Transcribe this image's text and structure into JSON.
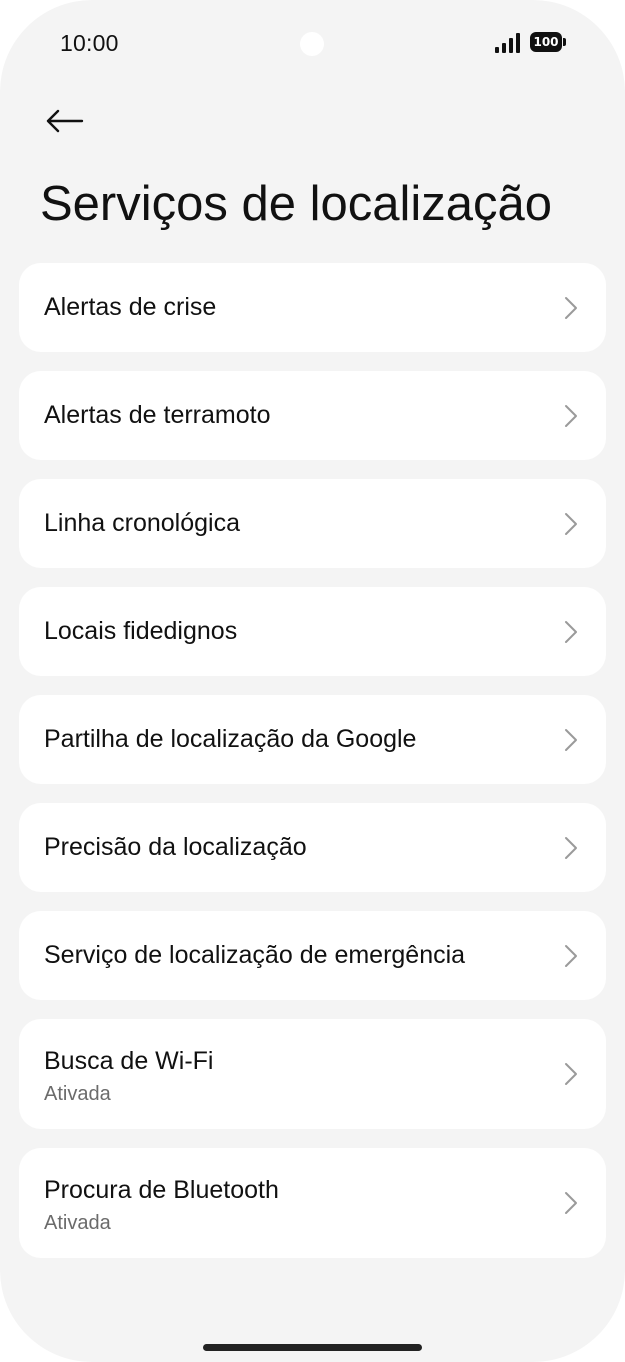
{
  "status_bar": {
    "time": "10:00",
    "battery": "100",
    "signal_icon": "signal-bars-icon",
    "battery_icon": "battery-icon"
  },
  "header": {
    "back_icon": "arrow-left-icon",
    "title": "Serviços de localização"
  },
  "items": [
    {
      "label": "Alertas de crise",
      "subtitle": ""
    },
    {
      "label": "Alertas de terramoto",
      "subtitle": ""
    },
    {
      "label": "Linha cronológica",
      "subtitle": ""
    },
    {
      "label": "Locais fidedignos",
      "subtitle": ""
    },
    {
      "label": "Partilha de localização da Google",
      "subtitle": ""
    },
    {
      "label": "Precisão da localização",
      "subtitle": ""
    },
    {
      "label": "Serviço de localização de emergência",
      "subtitle": ""
    },
    {
      "label": "Busca de Wi-Fi",
      "subtitle": "Ativada"
    },
    {
      "label": "Procura de Bluetooth",
      "subtitle": "Ativada"
    }
  ],
  "colors": {
    "background": "#f4f4f4",
    "card": "#ffffff",
    "text_primary": "#111111",
    "text_secondary": "#6b6b6b",
    "chevron": "#9a9a9a"
  }
}
